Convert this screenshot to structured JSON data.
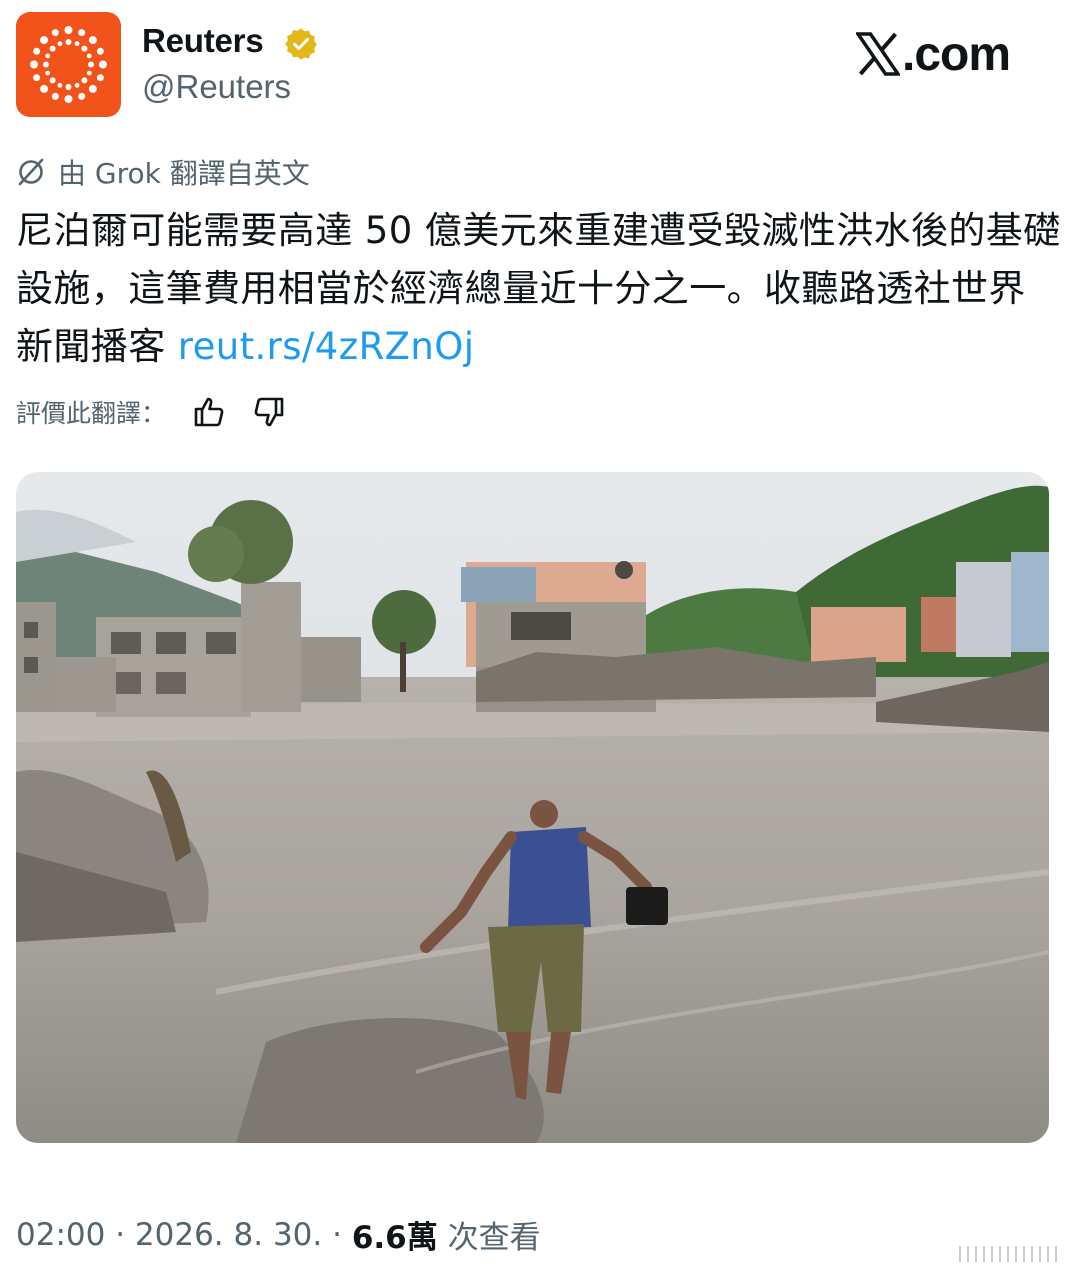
{
  "account": {
    "name": "Reuters",
    "handle": "@Reuters",
    "verified_icon": "verified-badge-gold",
    "brand_color": "#f2531b"
  },
  "site_logo": {
    "text": ".com"
  },
  "translation": {
    "label": "由 Grok 翻譯自英文"
  },
  "tweet": {
    "text": "尼泊爾可能需要高達 50 億美元來重建遭受毀滅性洪水後的基礎設施，這筆費用相當於經濟總量近十分之一。收聽路透社世界新聞播客 ",
    "link": "reut.rs/4zRZnOj",
    "link_color": "#1d9bf0"
  },
  "rating": {
    "label": "評價此翻譯：",
    "thumbs_up_icon": "thumbs-up-icon",
    "thumbs_down_icon": "thumbs-down-icon"
  },
  "media": {
    "description_icon": "photo"
  },
  "meta": {
    "time": "02:00",
    "sep1": " · ",
    "date": "2026. 8. 30.",
    "sep2": " · ",
    "views": "6.6萬",
    "views_label": " 次查看"
  }
}
